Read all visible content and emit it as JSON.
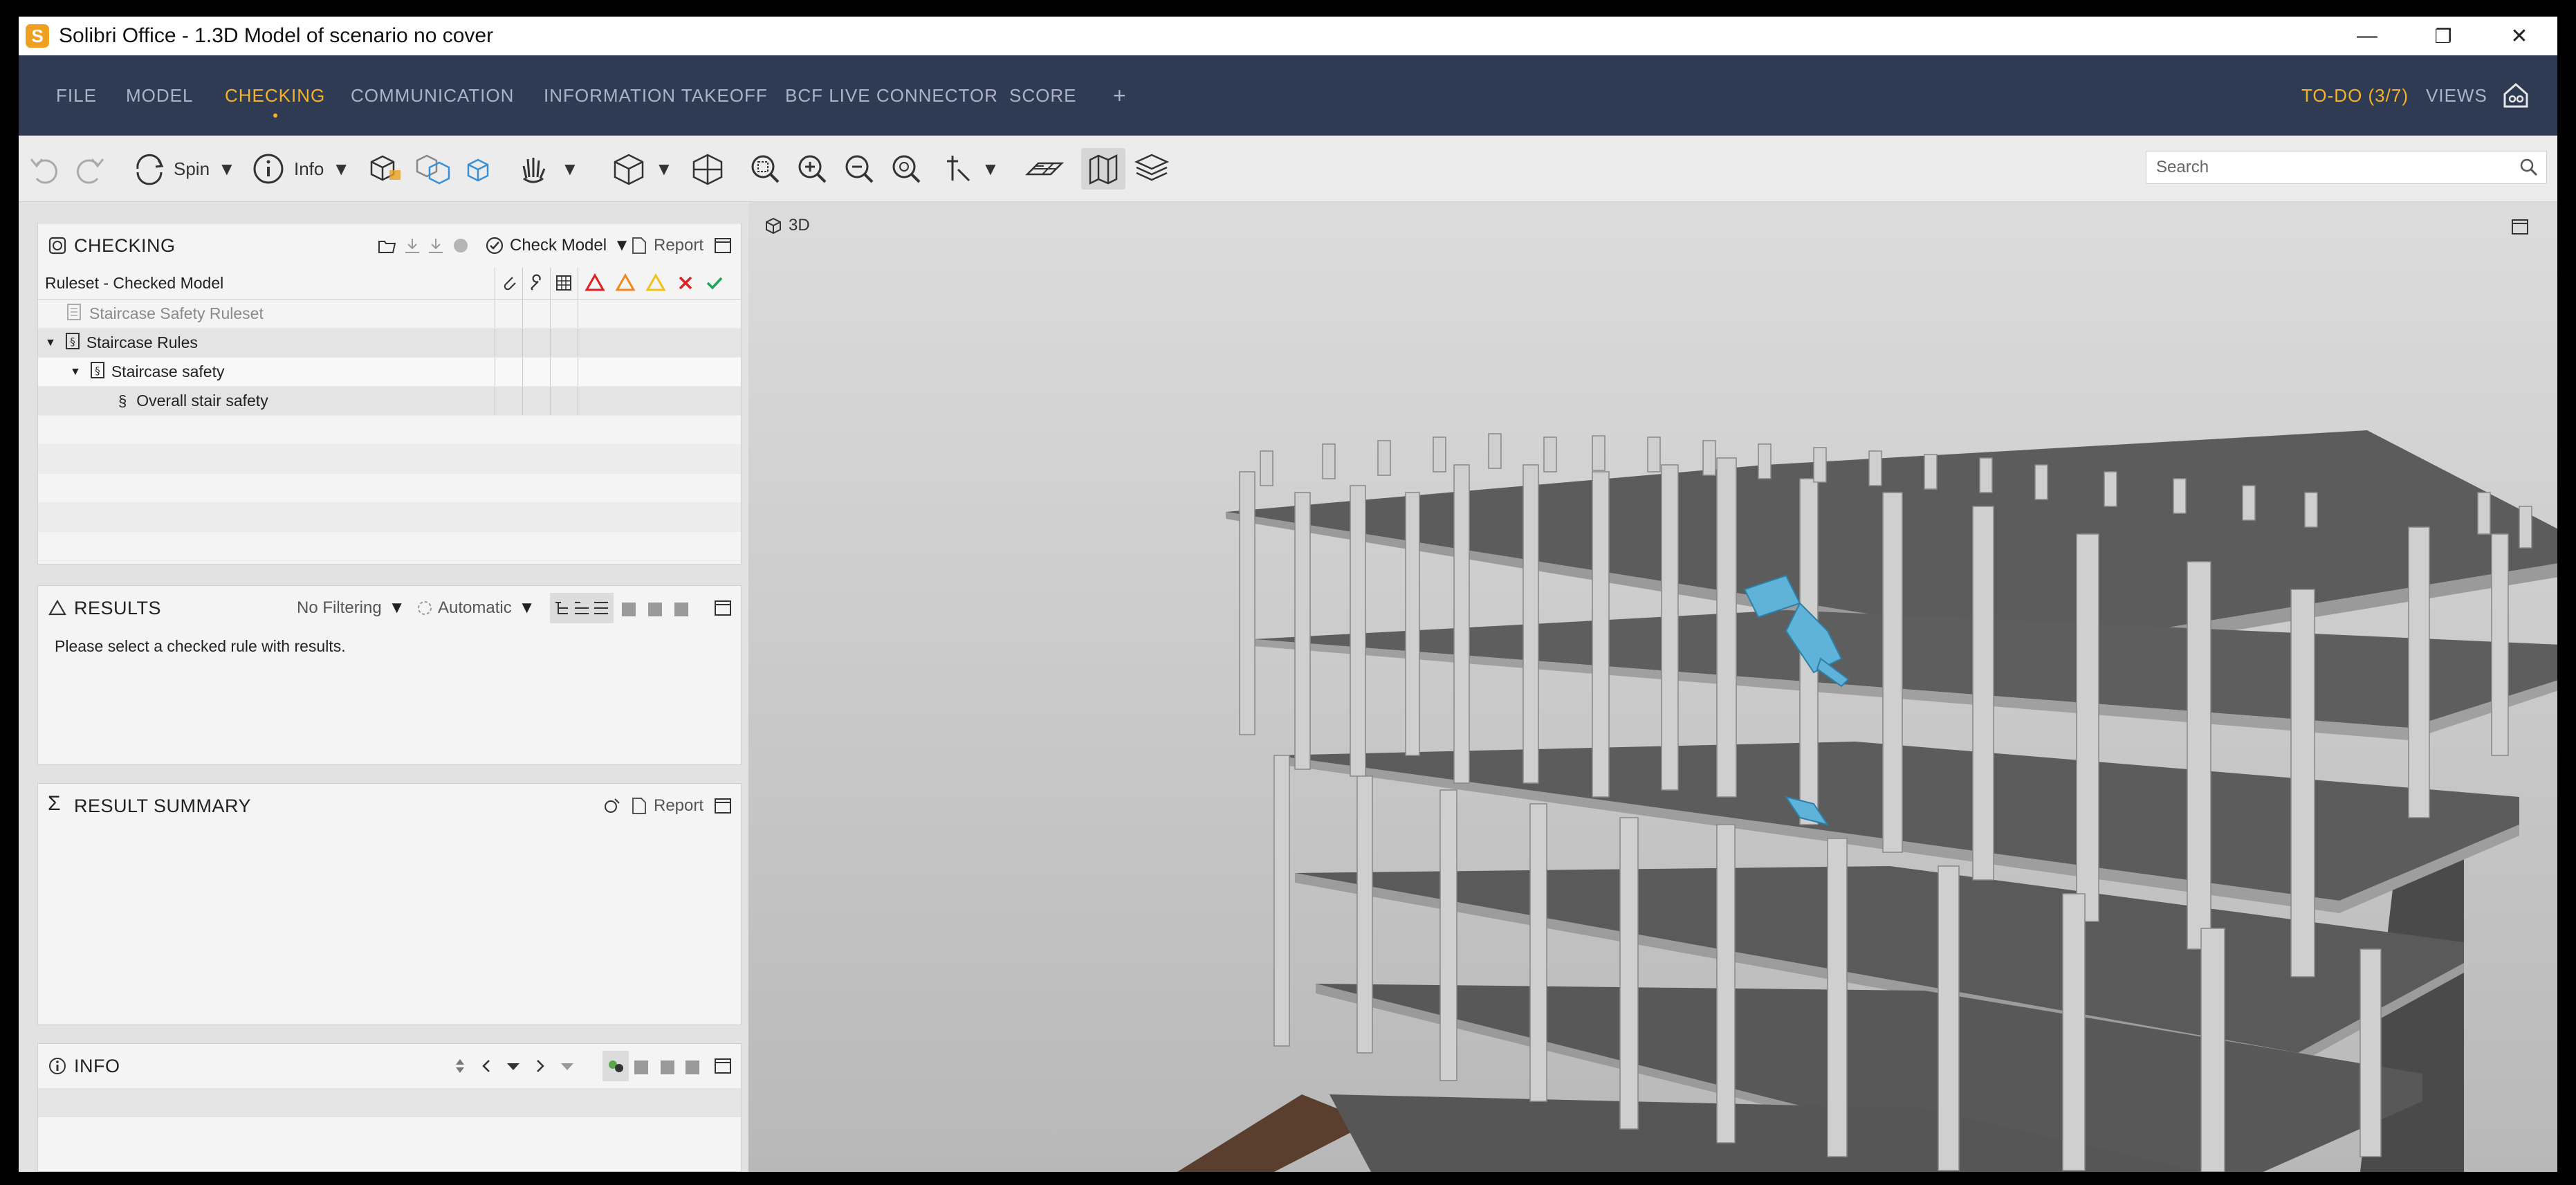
{
  "window": {
    "logo_letter": "S",
    "title": "Solibri Office - 1.3D Model of scenario no cover",
    "minimize": "—",
    "restore": "❐",
    "close": "✕"
  },
  "menu": {
    "items": [
      "FILE",
      "MODEL",
      "CHECKING",
      "COMMUNICATION",
      "INFORMATION TAKEOFF",
      "BCF LIVE CONNECTOR",
      "SCORE",
      "+"
    ],
    "active": "CHECKING",
    "todo": "TO-DO (3/7)",
    "views": "VIEWS"
  },
  "toolbar": {
    "spin_label": "Spin",
    "info_label": "Info",
    "search_placeholder": "Search"
  },
  "checking_panel": {
    "title": "CHECKING",
    "check_model_label": "Check Model",
    "report_label": "Report",
    "header_label": "Ruleset - Checked Model",
    "rows": [
      {
        "label": "Staircase Safety Ruleset",
        "indent": 0,
        "expander": "",
        "muted": true
      },
      {
        "label": "Staircase Rules",
        "indent": 0,
        "expander": "▼",
        "muted": false
      },
      {
        "label": "Staircase  safety",
        "indent": 1,
        "expander": "▼",
        "muted": false
      },
      {
        "label": "Overall stair safety",
        "indent": 2,
        "expander": "",
        "muted": false
      }
    ]
  },
  "results_panel": {
    "title": "RESULTS",
    "filter_label": "No Filtering",
    "mode_label": "Automatic",
    "message": "Please select a checked rule with results."
  },
  "summary_panel": {
    "title": "RESULT SUMMARY",
    "report_label": "Report"
  },
  "info_panel": {
    "title": "INFO"
  },
  "viewport": {
    "label": "3D"
  },
  "colors": {
    "menubar": "#2e3b52",
    "accent": "#f5b324",
    "stair": "#5fb3d9",
    "slab": "#5e5e5e",
    "column": "#cfcfcf"
  }
}
